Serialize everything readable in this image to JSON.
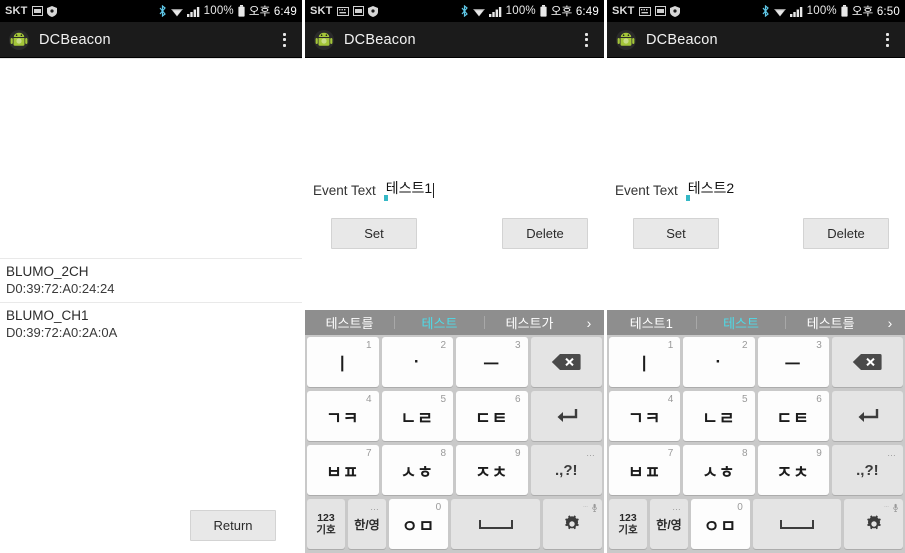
{
  "app": {
    "title": "DCBeacon",
    "icon": "android-robot-icon",
    "overflow_icon": "overflow-menu-icon"
  },
  "colors": {
    "accent_underline": "#35b8c6",
    "suggestion_highlight": "#4ddbe8",
    "statusbar_bg": "#000000",
    "actionbar_bg": "#1b1b1b",
    "keyboard_bg": "#c9c9c9",
    "suggestbar_bg": "#8e8e8e"
  },
  "panels": [
    {
      "status": {
        "carrier": "SKT",
        "icons": [
          "sim-icon",
          "shield-icon"
        ],
        "right_icons": [
          "bluetooth-icon",
          "wifi-icon",
          "signal-icon"
        ],
        "battery": "100%",
        "time": "오후 6:49"
      },
      "devices": [
        {
          "name": "BLUMO_2CH",
          "mac": "D0:39:72:A0:24:24"
        },
        {
          "name": "BLUMO_CH1",
          "mac": "D0:39:72:A0:2A:0A"
        }
      ],
      "return_label": "Return"
    },
    {
      "status": {
        "carrier": "SKT",
        "icons": [
          "keyboard-icon",
          "sim-icon",
          "shield-icon"
        ],
        "right_icons": [
          "bluetooth-icon",
          "wifi-icon",
          "signal-icon"
        ],
        "battery": "100%",
        "time": "오후 6:49"
      },
      "form": {
        "label": "Event Text",
        "value": "테스트1",
        "placeholder": "",
        "has_caret": true,
        "set_label": "Set",
        "delete_label": "Delete"
      },
      "keyboard": {
        "suggestions": [
          "테스트를",
          "테스트",
          "테스트가"
        ],
        "highlight_index": 1,
        "more_icon": "chevron-right-icon"
      }
    },
    {
      "status": {
        "carrier": "SKT",
        "icons": [
          "keyboard-icon",
          "sim-icon",
          "shield-icon"
        ],
        "right_icons": [
          "bluetooth-icon",
          "wifi-icon",
          "signal-icon"
        ],
        "battery": "100%",
        "time": "오후 6:50"
      },
      "form": {
        "label": "Event Text",
        "value": "테스트2",
        "placeholder": "",
        "has_caret": false,
        "set_label": "Set",
        "delete_label": "Delete"
      },
      "keyboard": {
        "suggestions": [
          "테스트1",
          "테스트",
          "테스트를"
        ],
        "highlight_index": 1,
        "more_icon": "chevron-right-icon"
      }
    }
  ],
  "keyboard_layout": {
    "rows": [
      [
        {
          "label": "ㅣ",
          "num": "1",
          "type": "char"
        },
        {
          "label": "·",
          "num": "2",
          "type": "char"
        },
        {
          "label": "ㅡ",
          "num": "3",
          "type": "char"
        },
        {
          "label": "backspace-icon",
          "type": "fn-backspace"
        }
      ],
      [
        {
          "label": "ㄱㅋ",
          "num": "4",
          "type": "char"
        },
        {
          "label": "ㄴㄹ",
          "num": "5",
          "type": "char"
        },
        {
          "label": "ㄷㅌ",
          "num": "6",
          "type": "char"
        },
        {
          "label": "enter-icon",
          "type": "fn-enter"
        }
      ],
      [
        {
          "label": "ㅂㅍ",
          "num": "7",
          "type": "char"
        },
        {
          "label": "ㅅㅎ",
          "num": "8",
          "type": "char"
        },
        {
          "label": "ㅈㅊ",
          "num": "9",
          "type": "char"
        },
        {
          "label": ".,?!",
          "type": "fn-punct"
        }
      ],
      [
        {
          "label": "123\n기호",
          "type": "fn-symbols"
        },
        {
          "label": "한/영",
          "type": "fn-lang"
        },
        {
          "label": "ㅇㅁ",
          "num": "0",
          "type": "char"
        },
        {
          "label": "space-icon",
          "type": "fn-space"
        },
        {
          "label": "gear-icon",
          "type": "fn-settings"
        }
      ]
    ]
  }
}
